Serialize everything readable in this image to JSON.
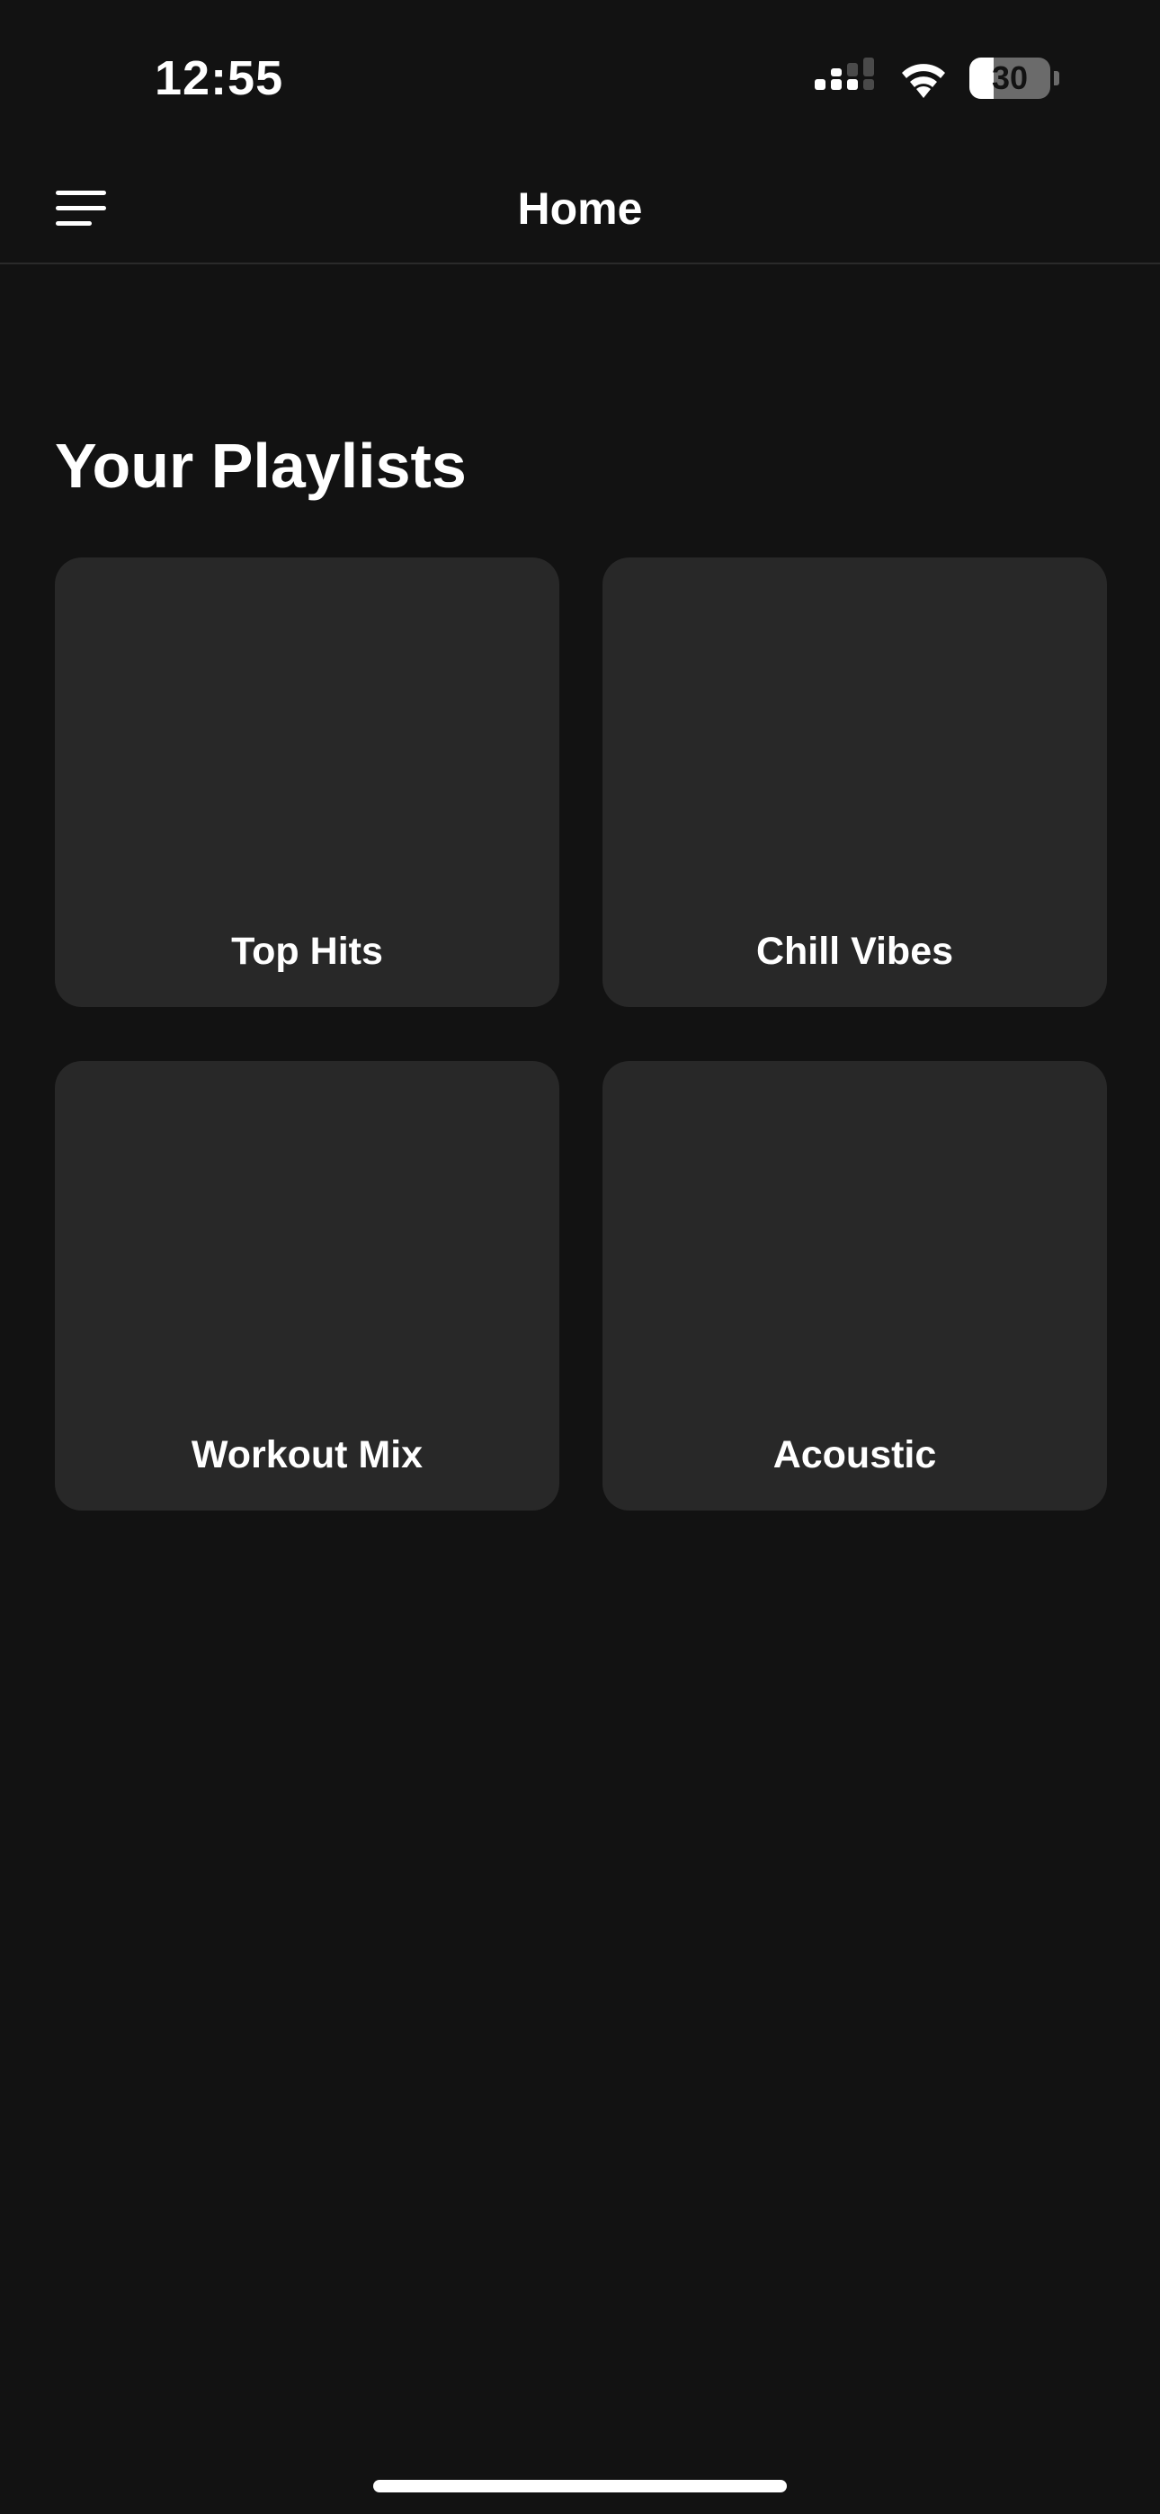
{
  "status_bar": {
    "time": "12:55",
    "battery_level": "30",
    "battery_fraction": 0.3,
    "icons": [
      "signal-icon",
      "wifi-icon",
      "battery-icon"
    ]
  },
  "nav": {
    "title": "Home",
    "menu_icon": "hamburger-menu-icon"
  },
  "section": {
    "title": "Your Playlists"
  },
  "playlists": [
    {
      "name": "Top Hits"
    },
    {
      "name": "Chill Vibes"
    },
    {
      "name": "Workout Mix"
    },
    {
      "name": "Acoustic"
    }
  ],
  "colors": {
    "background": "#121212",
    "card": "#282828",
    "text": "#ffffff",
    "divider": "#2a2a2a"
  }
}
